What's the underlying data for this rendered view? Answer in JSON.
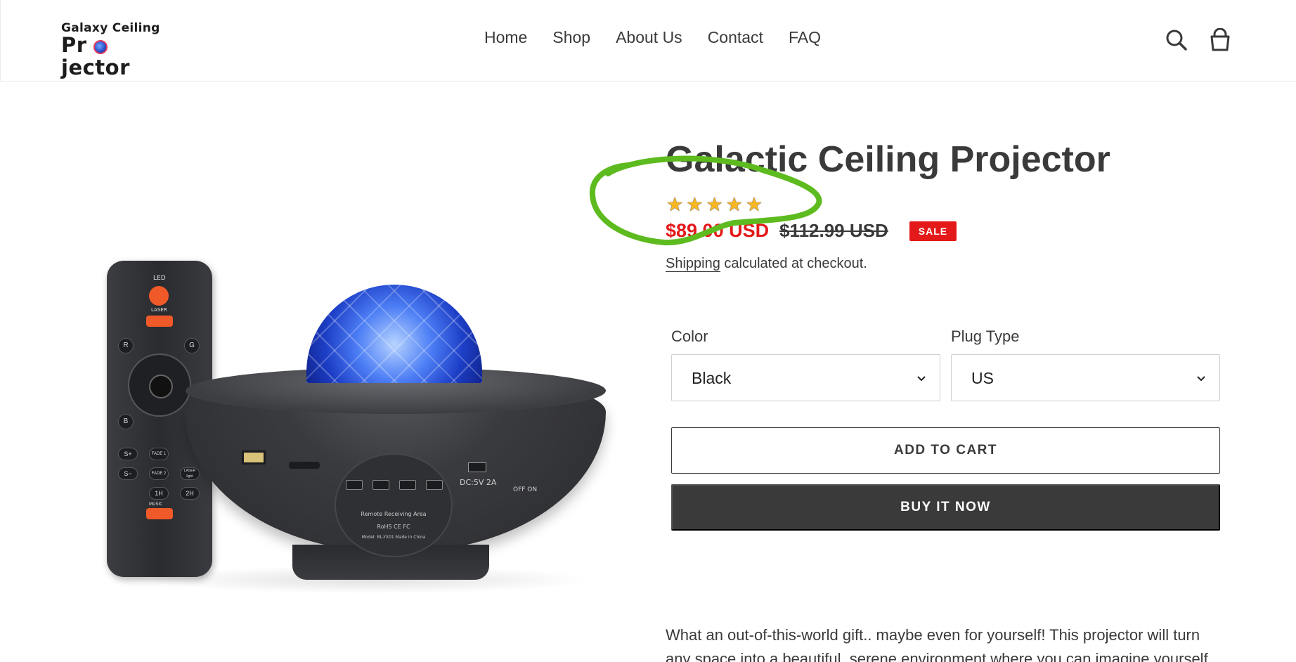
{
  "brand": {
    "logo_line1": "Galaxy Ceiling",
    "logo_line2_pre": "Pr",
    "logo_line2_post": "jector"
  },
  "nav": {
    "items": [
      "Home",
      "Shop",
      "About Us",
      "Contact",
      "FAQ"
    ]
  },
  "header_icons": [
    "search-icon",
    "cart-icon"
  ],
  "product": {
    "title": "Galactic Ceiling Projector",
    "rating_stars": 5,
    "sale_price": "$89.00 USD",
    "regular_price": "$112.99 USD",
    "sale_badge": "SALE",
    "shipping_link": "Shipping",
    "shipping_text": " calculated at checkout.",
    "options": {
      "color_label": "Color",
      "color_value": "Black",
      "plug_label": "Plug Type",
      "plug_value": "US"
    },
    "add_to_cart_label": "ADD TO CART",
    "buy_now_label": "BUY IT NOW",
    "description_line1": "What an out-of-this-world gift.. maybe even for yourself!  This projector will turn",
    "description_line2": "any space into a beautiful, serene environment where you can imagine yourself"
  },
  "image": {
    "remote_labels": [
      "LED",
      "LASER",
      "R",
      "G",
      "B",
      "S+",
      "FADE 1",
      "S−",
      "FADE 2",
      "LASER light",
      "1H",
      "2H",
      "MUSIC"
    ],
    "panel_text_1": "Remote Receiving Area",
    "panel_text_2": "RoHS CE FC",
    "panel_text_3": "Model: BL-YX01   Made in China",
    "dc_label": "DC:5V 2A",
    "onoff_label": "OFF ON"
  },
  "colors": {
    "sale_red": "#e4191a",
    "text_dark": "#3a3a3a",
    "annotation_green": "#5dbb1f",
    "star_gold": "#f7b622"
  }
}
